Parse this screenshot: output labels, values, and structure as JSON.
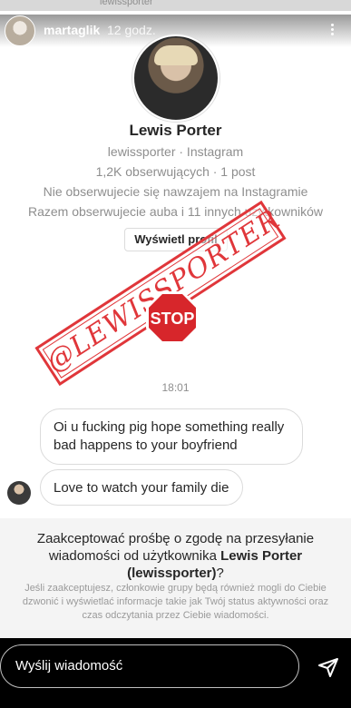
{
  "top_strip": {
    "text": "lewissporter"
  },
  "header": {
    "username": "martaglik",
    "time": "12 godz."
  },
  "profile": {
    "name": "Lewis Porter",
    "handle": "lewissporter · Instagram",
    "stats": "1,2K obserwujących · 1 post",
    "note1": "Nie obserwujecie się nawzajem na Instagramie",
    "note2": "Razem obserwujecie auba i 11 innych użytkowników",
    "view_button": "Wyświetl profil"
  },
  "stamp": {
    "text": "@LEWISSPORTER"
  },
  "sticker": {
    "text": "STOP",
    "color": "#d7262b"
  },
  "conversation": {
    "timestamp": "18:01",
    "messages": [
      "Oi u fucking pig hope something really bad happens to your boyfriend",
      "Love to watch your family die"
    ]
  },
  "request": {
    "title_pre": "Zaakceptować prośbę o zgodę na przesyłanie wiadomości od użytkownika",
    "title_name": "Lewis Porter",
    "title_handle": "(lewissporter)",
    "title_end": "?",
    "subtext": "Jeśli zaakceptujesz, członkowie grupy będą również mogli do Ciebie dzwonić i wyświetlać informacje takie jak Twój status aktywności oraz czas odczytania przez Ciebie wiadomości."
  },
  "bottom": {
    "input_placeholder": "Wyślij wiadomość"
  },
  "colors": {
    "stamp": "#e0363a",
    "panel": "#f4f4f4"
  }
}
